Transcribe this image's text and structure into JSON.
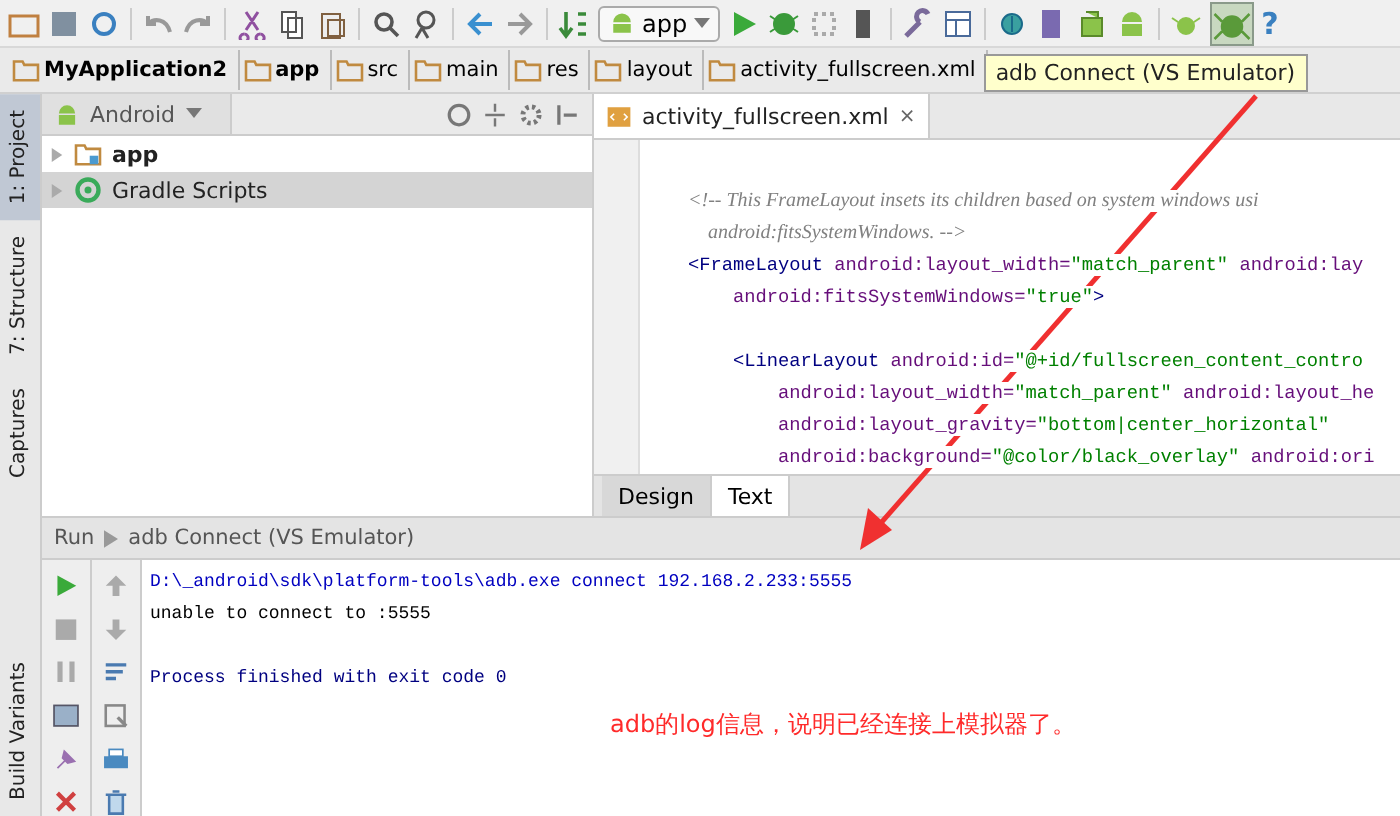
{
  "toolbar": {
    "run_config": "app",
    "tooltip": "adb Connect (VS Emulator)",
    "help": "?"
  },
  "breadcrumbs": [
    {
      "label": "MyApplication2",
      "bold": true
    },
    {
      "label": "app",
      "bold": true
    },
    {
      "label": "src",
      "bold": false
    },
    {
      "label": "main",
      "bold": false
    },
    {
      "label": "res",
      "bold": false
    },
    {
      "label": "layout",
      "bold": false
    },
    {
      "label": "activity_fullscreen.xml",
      "bold": false
    }
  ],
  "side_tabs": [
    {
      "label": "1: Project",
      "selected": true
    },
    {
      "label": "7: Structure",
      "selected": false
    },
    {
      "label": "Captures",
      "selected": false
    },
    {
      "label": "Build Variants",
      "selected": false
    }
  ],
  "project": {
    "view": "Android",
    "items": [
      {
        "label": "app",
        "bold": true,
        "selected": false,
        "expanded": false
      },
      {
        "label": "Gradle Scripts",
        "bold": false,
        "selected": true,
        "expanded": false
      }
    ]
  },
  "editor": {
    "tab": {
      "label": "activity_fullscreen.xml",
      "close": "×"
    },
    "lines": [
      {
        "kind": "blank"
      },
      {
        "kind": "code",
        "segments": [
          {
            "kind": "comment",
            "text": "<!-- This FrameLayout insets its children based on system windows usi"
          }
        ]
      },
      {
        "kind": "code",
        "segments": [
          {
            "kind": "comment",
            "text": "    android:fitsSystemWindows. -->"
          }
        ]
      },
      {
        "kind": "code",
        "segments": [
          {
            "kind": "tag",
            "text": "<FrameLayout"
          },
          {
            "kind": "attr",
            "text": " android:layout_width="
          },
          {
            "kind": "value",
            "text": "\"match_parent\""
          },
          {
            "kind": "attr",
            "text": " android:lay"
          }
        ]
      },
      {
        "kind": "code",
        "segments": [
          {
            "kind": "attr",
            "text": "    android:fitsSystemWindows="
          },
          {
            "kind": "value",
            "text": "\"true\""
          },
          {
            "kind": "tag",
            "text": ">"
          }
        ]
      },
      {
        "kind": "blank"
      },
      {
        "kind": "code",
        "segments": [
          {
            "kind": "tag",
            "text": "    <LinearLayout"
          },
          {
            "kind": "attr",
            "text": " android:id="
          },
          {
            "kind": "value",
            "text": "\"@+id/fullscreen_content_contro"
          }
        ]
      },
      {
        "kind": "code",
        "segments": [
          {
            "kind": "attr",
            "text": "        android:layout_width="
          },
          {
            "kind": "value",
            "text": "\"match_parent\""
          },
          {
            "kind": "attr",
            "text": " android:layout_he"
          }
        ]
      },
      {
        "kind": "code",
        "segments": [
          {
            "kind": "attr",
            "text": "        android:layout_gravity="
          },
          {
            "kind": "value",
            "text": "\"bottom|center_horizontal\""
          }
        ]
      },
      {
        "kind": "code",
        "segments": [
          {
            "kind": "attr",
            "text": "        android:background="
          },
          {
            "kind": "value",
            "text": "\"@color/black_overlay\""
          },
          {
            "kind": "attr",
            "text": " android:ori"
          }
        ]
      }
    ],
    "bottom_tabs": [
      {
        "label": "Design",
        "selected": false
      },
      {
        "label": "Text",
        "selected": true
      }
    ]
  },
  "run": {
    "title": "Run",
    "config": "adb Connect (VS Emulator)",
    "console": [
      {
        "kind": "command",
        "text": "D:\\_android\\sdk\\platform-tools\\adb.exe connect 192.168.2.233:5555"
      },
      {
        "kind": "output",
        "text": "unable to connect to :5555"
      },
      {
        "kind": "blank"
      },
      {
        "kind": "system",
        "text": "Process finished with exit code 0"
      }
    ]
  },
  "annotation": "adb的log信息，说明已经连接上模拟器了。"
}
